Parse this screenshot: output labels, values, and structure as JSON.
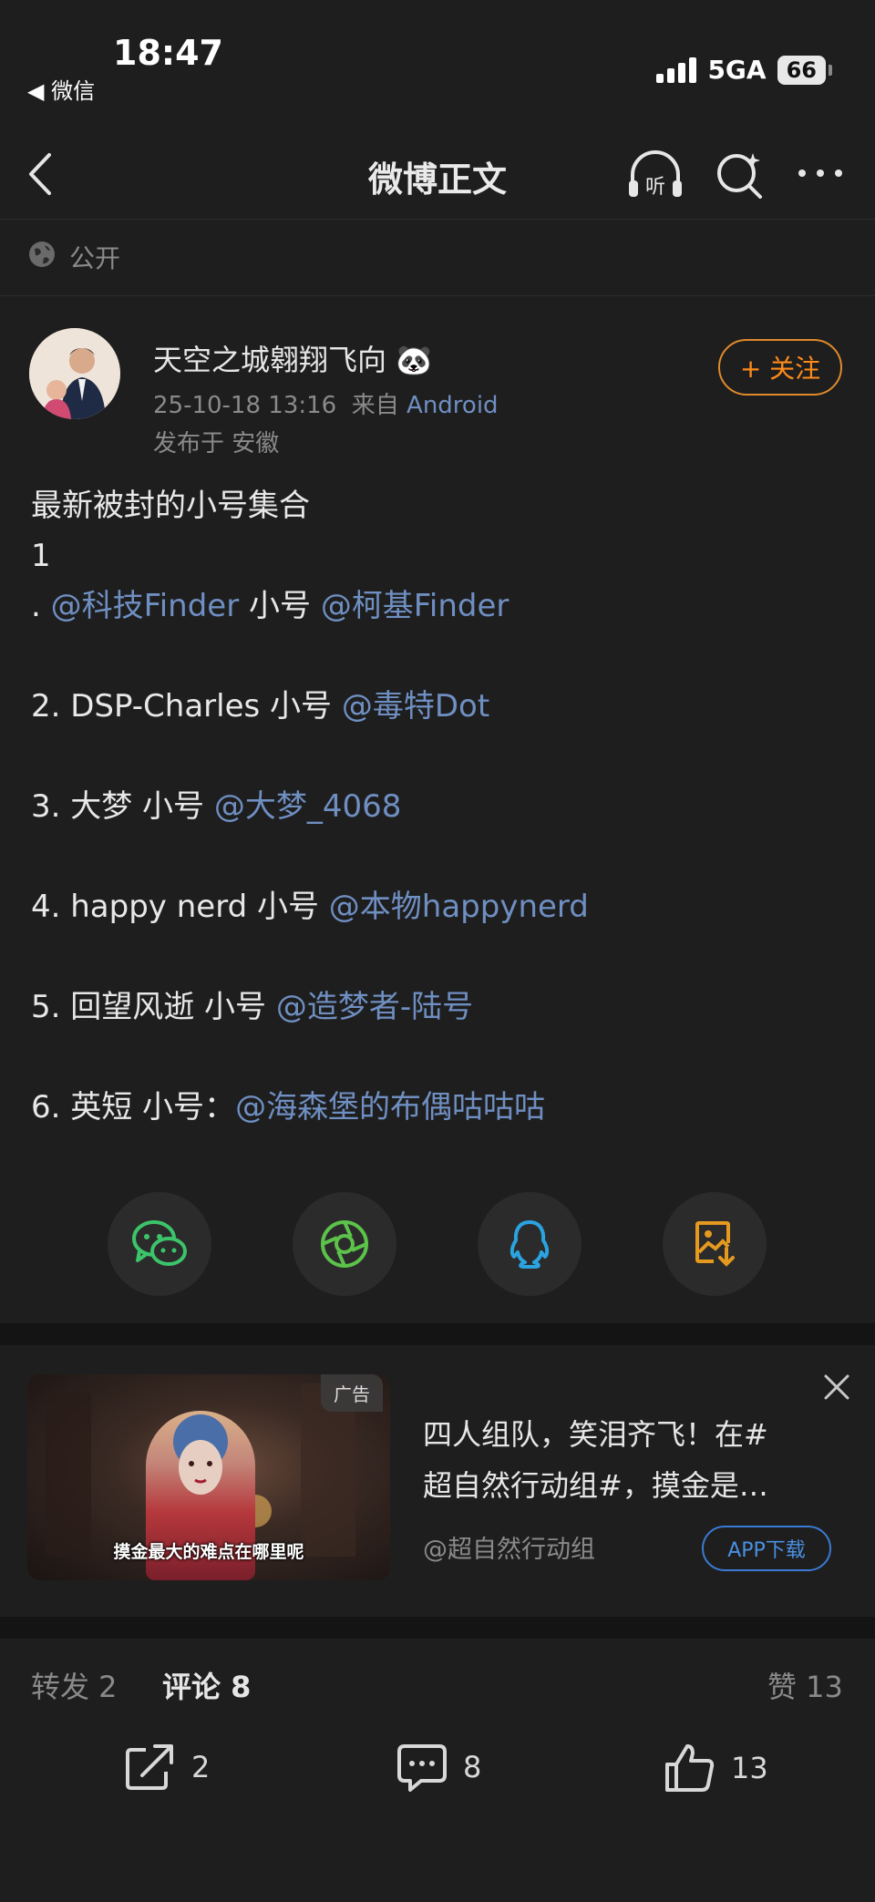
{
  "status_bar": {
    "time": "18:47",
    "back_app": "◀ 微信",
    "network": "5GA",
    "battery": "66"
  },
  "nav": {
    "title": "微博正文",
    "listen_label": "听"
  },
  "visibility": "公开",
  "author": {
    "name": "天空之城翱翔飞向",
    "name_emoji": "🐼",
    "date": "25-10-18 13:16",
    "from_label": "来自",
    "source": "Android",
    "location": "发布于 安徽",
    "follow_label": "+ 关注"
  },
  "post": {
    "title": "最新被封的小号集合",
    "items": [
      {
        "num": "1",
        "pre": ".",
        "name": "",
        "mention1": "@科技Finder",
        "sep": " 小号 ",
        "mention2": "@柯基Finder"
      },
      {
        "pre": "2. DSP-Charles 小号 ",
        "mention": "@毒特Dot"
      },
      {
        "pre": "3. 大梦 小号 ",
        "mention": "@大梦_4068"
      },
      {
        "pre": "4. happy nerd 小号 ",
        "mention": "@本物happynerd"
      },
      {
        "pre": "5. 回望风逝 小号 ",
        "mention": "@造梦者-陆号"
      },
      {
        "pre": "6. 英短 小号：",
        "mention": "@海森堡的布偶咕咕咕"
      }
    ]
  },
  "share_icons": [
    "wechat-icon",
    "moments-icon",
    "qq-icon",
    "save-image-icon"
  ],
  "ad": {
    "tag": "广告",
    "caption": "摸金最大的难点在哪里呢",
    "text": "四人组队，笑泪齐飞！在#超自然行动组#，摸金是…",
    "text_line1": "四人组队，笑泪齐飞！在#",
    "text_line2": "超自然行动组#，摸金是…",
    "handle": "@超自然行动组",
    "cta": "APP下载"
  },
  "counts": {
    "repost_label": "转发 2",
    "comment_label": "评论 8",
    "like_label": "赞 13"
  },
  "actions": {
    "repost": "2",
    "comment": "8",
    "like": "13"
  },
  "colors": {
    "background": "#1e1e1e",
    "mention": "#6f8fc2",
    "follow": "#ff8c1a",
    "cta": "#4a90e2"
  }
}
